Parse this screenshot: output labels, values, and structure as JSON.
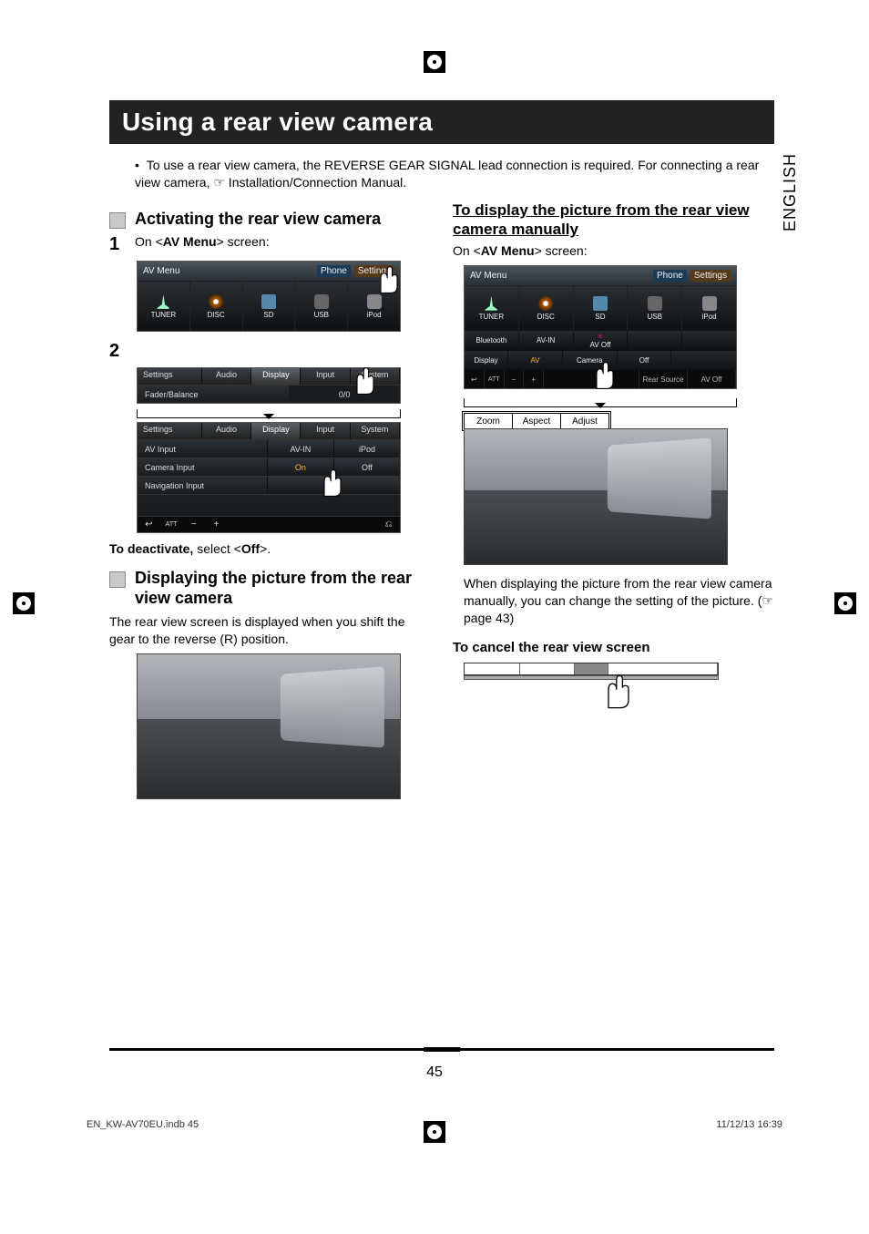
{
  "language_tab": "ENGLISH",
  "page_title": "Using a rear view camera",
  "intro_bullet": "To use a rear view camera, the REVERSE GEAR SIGNAL lead connection is required. For connecting a rear view camera, ☞ Installation/Connection Manual.",
  "section_activate": "Activating the rear view camera",
  "step1_num": "1",
  "step1_text_pre": "On <",
  "step1_bold": "AV Menu",
  "step1_text_post": "> screen:",
  "step2_num": "2",
  "avmenu_label": "AV Menu",
  "avmenu_phone": "Phone",
  "avmenu_settings": "Settings",
  "src_tuner": "TUNER",
  "src_disc": "DISC",
  "src_sd": "SD",
  "src_usb": "USB",
  "src_ipod": "iPod",
  "src_bt": "Bluetooth",
  "src_avin": "AV-IN",
  "src_avoff": "AV Off",
  "settings_label": "Settings",
  "tab_audio": "Audio",
  "tab_display": "Display",
  "tab_input": "Input",
  "tab_system": "System",
  "row_fader": "Fader/Balance",
  "row_fader_val": "0/0",
  "row_avinput": "AV Input",
  "row_avinput_v1": "AV-IN",
  "row_avinput_v2": "iPod",
  "row_camera": "Camera Input",
  "row_camera_on": "On",
  "row_camera_off": "Off",
  "row_nav": "Navigation Input",
  "deactivate_pre": "To deactivate,",
  "deactivate_mid": " select <",
  "deactivate_bold": "Off",
  "deactivate_post": ">.",
  "section_display": "Displaying the picture from the rear view camera",
  "displaying_body": "The rear view screen is displayed when you shift the gear to the reverse (R) position.",
  "right_head": "To display the picture from the rear view camera manually",
  "right_on_pre": "On <",
  "right_on_bold": "AV Menu",
  "right_on_post": "> screen:",
  "disp_row_label": "Display",
  "disp_av": "AV",
  "disp_camera": "Camera",
  "disp_off": "Off",
  "bb_rear": "Rear Source",
  "bb_avoff": "AV Off",
  "zoom": "Zoom",
  "aspect": "Aspect",
  "adjust": "Adjust",
  "right_body": "When displaying the picture from the rear view camera manually, you can change the setting of the picture. (☞ page 43)",
  "cancel_head": "To cancel the rear view screen",
  "page_number": "45",
  "footer_left": "EN_KW-AV70EU.indb   45",
  "footer_right": "11/12/13   16:39"
}
